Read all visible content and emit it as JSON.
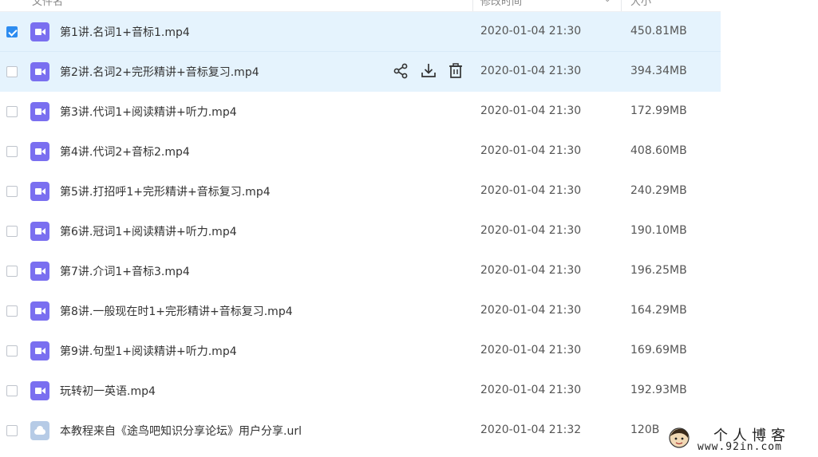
{
  "header": {
    "name_col": "文件名",
    "date_col": "修改时间",
    "size_col": "大小"
  },
  "actions": {
    "share_icon": "share-icon",
    "download_icon": "download-icon",
    "delete_icon": "delete-icon"
  },
  "files": [
    {
      "name": "第1讲.名词1+音标1.mp4",
      "date": "2020-01-04 21:30",
      "size": "450.81MB",
      "type": "video",
      "checked": true
    },
    {
      "name": "第2讲.名词2+完形精讲+音标复习.mp4",
      "date": "2020-01-04 21:30",
      "size": "394.34MB",
      "type": "video",
      "checked": false
    },
    {
      "name": "第3讲.代词1+阅读精讲+听力.mp4",
      "date": "2020-01-04 21:30",
      "size": "172.99MB",
      "type": "video",
      "checked": false
    },
    {
      "name": "第4讲.代词2+音标2.mp4",
      "date": "2020-01-04 21:30",
      "size": "408.60MB",
      "type": "video",
      "checked": false
    },
    {
      "name": "第5讲.打招呼1+完形精讲+音标复习.mp4",
      "date": "2020-01-04 21:30",
      "size": "240.29MB",
      "type": "video",
      "checked": false
    },
    {
      "name": "第6讲.冠词1+阅读精讲+听力.mp4",
      "date": "2020-01-04 21:30",
      "size": "190.10MB",
      "type": "video",
      "checked": false
    },
    {
      "name": "第7讲.介词1+音标3.mp4",
      "date": "2020-01-04 21:30",
      "size": "196.25MB",
      "type": "video",
      "checked": false
    },
    {
      "name": "第8讲.一般现在时1+完形精讲+音标复习.mp4",
      "date": "2020-01-04 21:30",
      "size": "164.29MB",
      "type": "video",
      "checked": false
    },
    {
      "name": "第9讲.句型1+阅读精讲+听力.mp4",
      "date": "2020-01-04 21:30",
      "size": "169.69MB",
      "type": "video",
      "checked": false
    },
    {
      "name": "玩转初一英语.mp4",
      "date": "2020-01-04 21:30",
      "size": "192.93MB",
      "type": "video",
      "checked": false
    },
    {
      "name": "本教程来自《途鸟吧知识分享论坛》用户分享.url",
      "date": "2020-01-04 21:32",
      "size": "120B",
      "type": "link",
      "checked": false
    }
  ],
  "watermark": {
    "title": "个人博客",
    "url": "www.92in.com"
  },
  "colors": {
    "selected_row": "#e5f3fd",
    "video_icon": "#7a6ff0",
    "checkbox_checked": "#2d8cf0"
  }
}
